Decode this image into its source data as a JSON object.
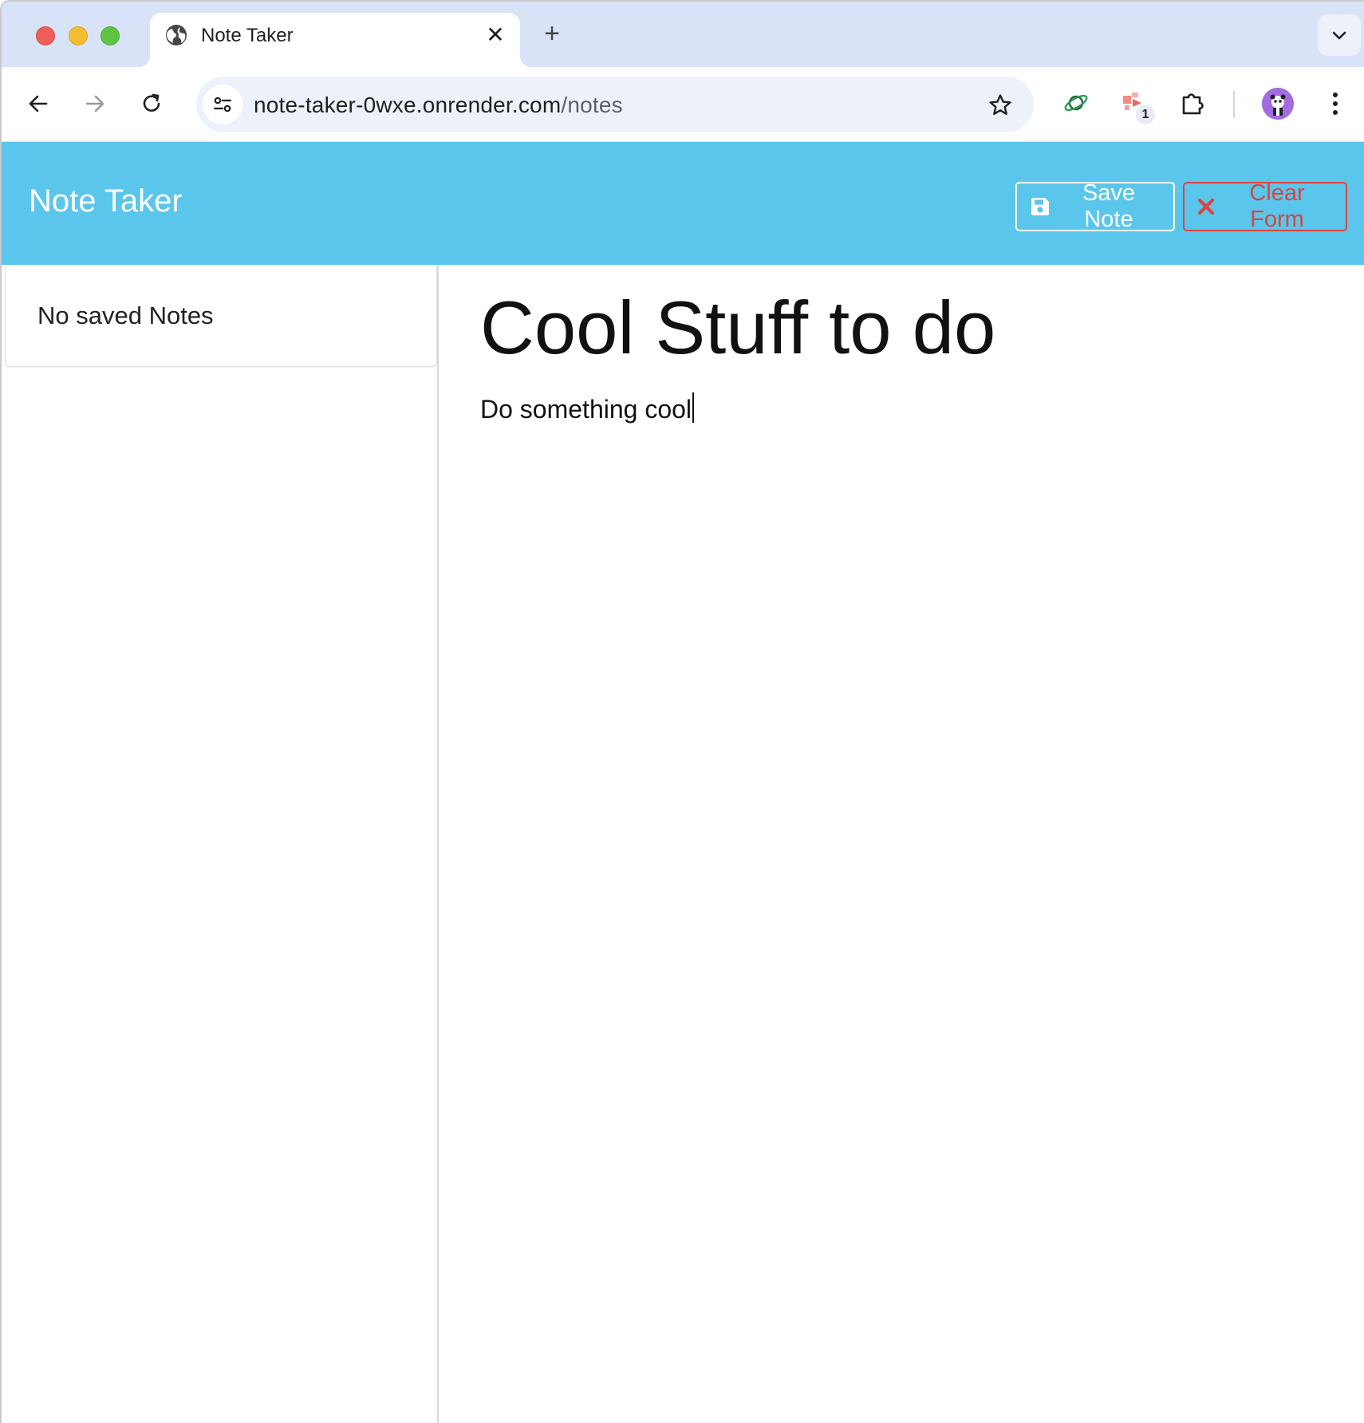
{
  "browser": {
    "tab": {
      "title": "Note Taker",
      "favicon": "globe-icon",
      "close_glyph": "✕"
    },
    "new_tab_glyph": "+",
    "url": {
      "host": "note-taker-0wxe.onrender.com",
      "path": "/notes"
    },
    "extensions": [
      {
        "name": "planet-extension-icon"
      },
      {
        "name": "puzzle-red-extension-icon",
        "badge": "1"
      },
      {
        "name": "extensions-puzzle-icon"
      }
    ]
  },
  "app": {
    "brand": "Note Taker",
    "buttons": {
      "save": {
        "label": "Save Note",
        "icon": "floppy-disk-icon",
        "color": "#ffffff"
      },
      "clear": {
        "label": "Clear Form",
        "icon": "x-icon",
        "color": "#d9453f"
      }
    },
    "navbar_color": "#5bc6eb",
    "sidebar": {
      "empty_message": "No saved Notes"
    },
    "editor": {
      "title": "Cool Stuff to do",
      "body": "Do something cool"
    }
  }
}
